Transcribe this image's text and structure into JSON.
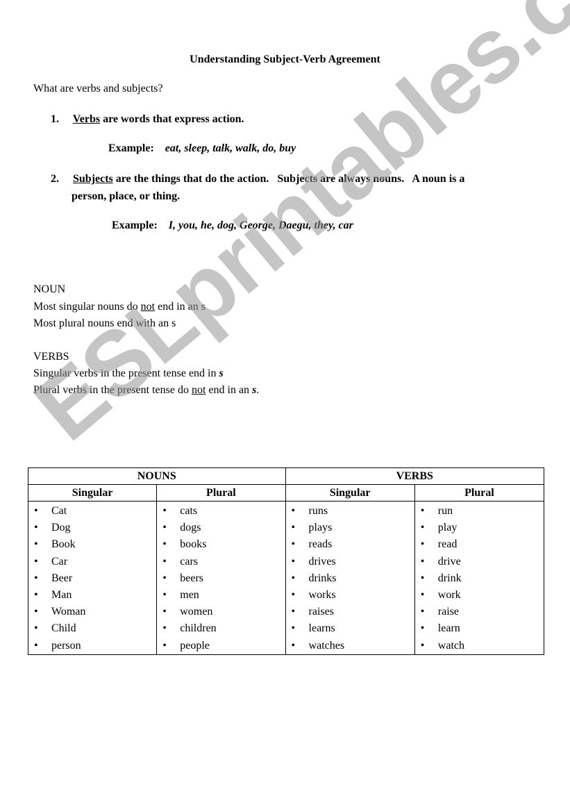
{
  "title": "Understanding Subject-Verb Agreement",
  "intro_question": "What are verbs and subjects?",
  "definitions": [
    {
      "number": "1.",
      "term": "Verbs",
      "text": " are words that express action.",
      "text_line2": "",
      "example_label": "Example:",
      "example_words": "eat, sleep, talk, walk, do, buy"
    },
    {
      "number": "2.",
      "term": "Subjects",
      "text": " are the things that do the action.   Subjects are always nouns.   A noun is a",
      "text_line2": "person, place, or thing.",
      "example_label": "Example:",
      "example_words": "I, you, he, dog, George, Daegu, they, car"
    }
  ],
  "rules": {
    "noun": {
      "heading": "NOUN",
      "line1_pre": "Most singular nouns do ",
      "line1_underlined": "not",
      "line1_post": " end in an s",
      "line2": "Most plural nouns end with an s"
    },
    "verbs": {
      "heading": "VERBS",
      "line1_pre": "Singular verbs in the present tense end in ",
      "line1_italic": "s",
      "line2_pre": "Plural verbs in the present tense do ",
      "line2_underlined": "not",
      "line2_mid": " end in an ",
      "line2_italic": "s",
      "line2_post": "."
    }
  },
  "table": {
    "groups": [
      "NOUNS",
      "VERBS"
    ],
    "subheaders": [
      "Singular",
      "Plural",
      "Singular",
      "Plural"
    ],
    "columns": [
      [
        "Cat",
        "Dog",
        "Book",
        "Car",
        "Beer",
        "Man",
        "Woman",
        "Child",
        "person"
      ],
      [
        "cats",
        "dogs",
        "books",
        "cars",
        "beers",
        "men",
        "women",
        "children",
        "people"
      ],
      [
        "runs",
        "plays",
        "reads",
        "drives",
        "drinks",
        "works",
        "raises",
        "learns",
        "watches"
      ],
      [
        "run",
        "play",
        "read",
        "drive",
        "drink",
        "work",
        "raise",
        "learn",
        "watch"
      ]
    ]
  },
  "watermark": "ESLprintables.com"
}
